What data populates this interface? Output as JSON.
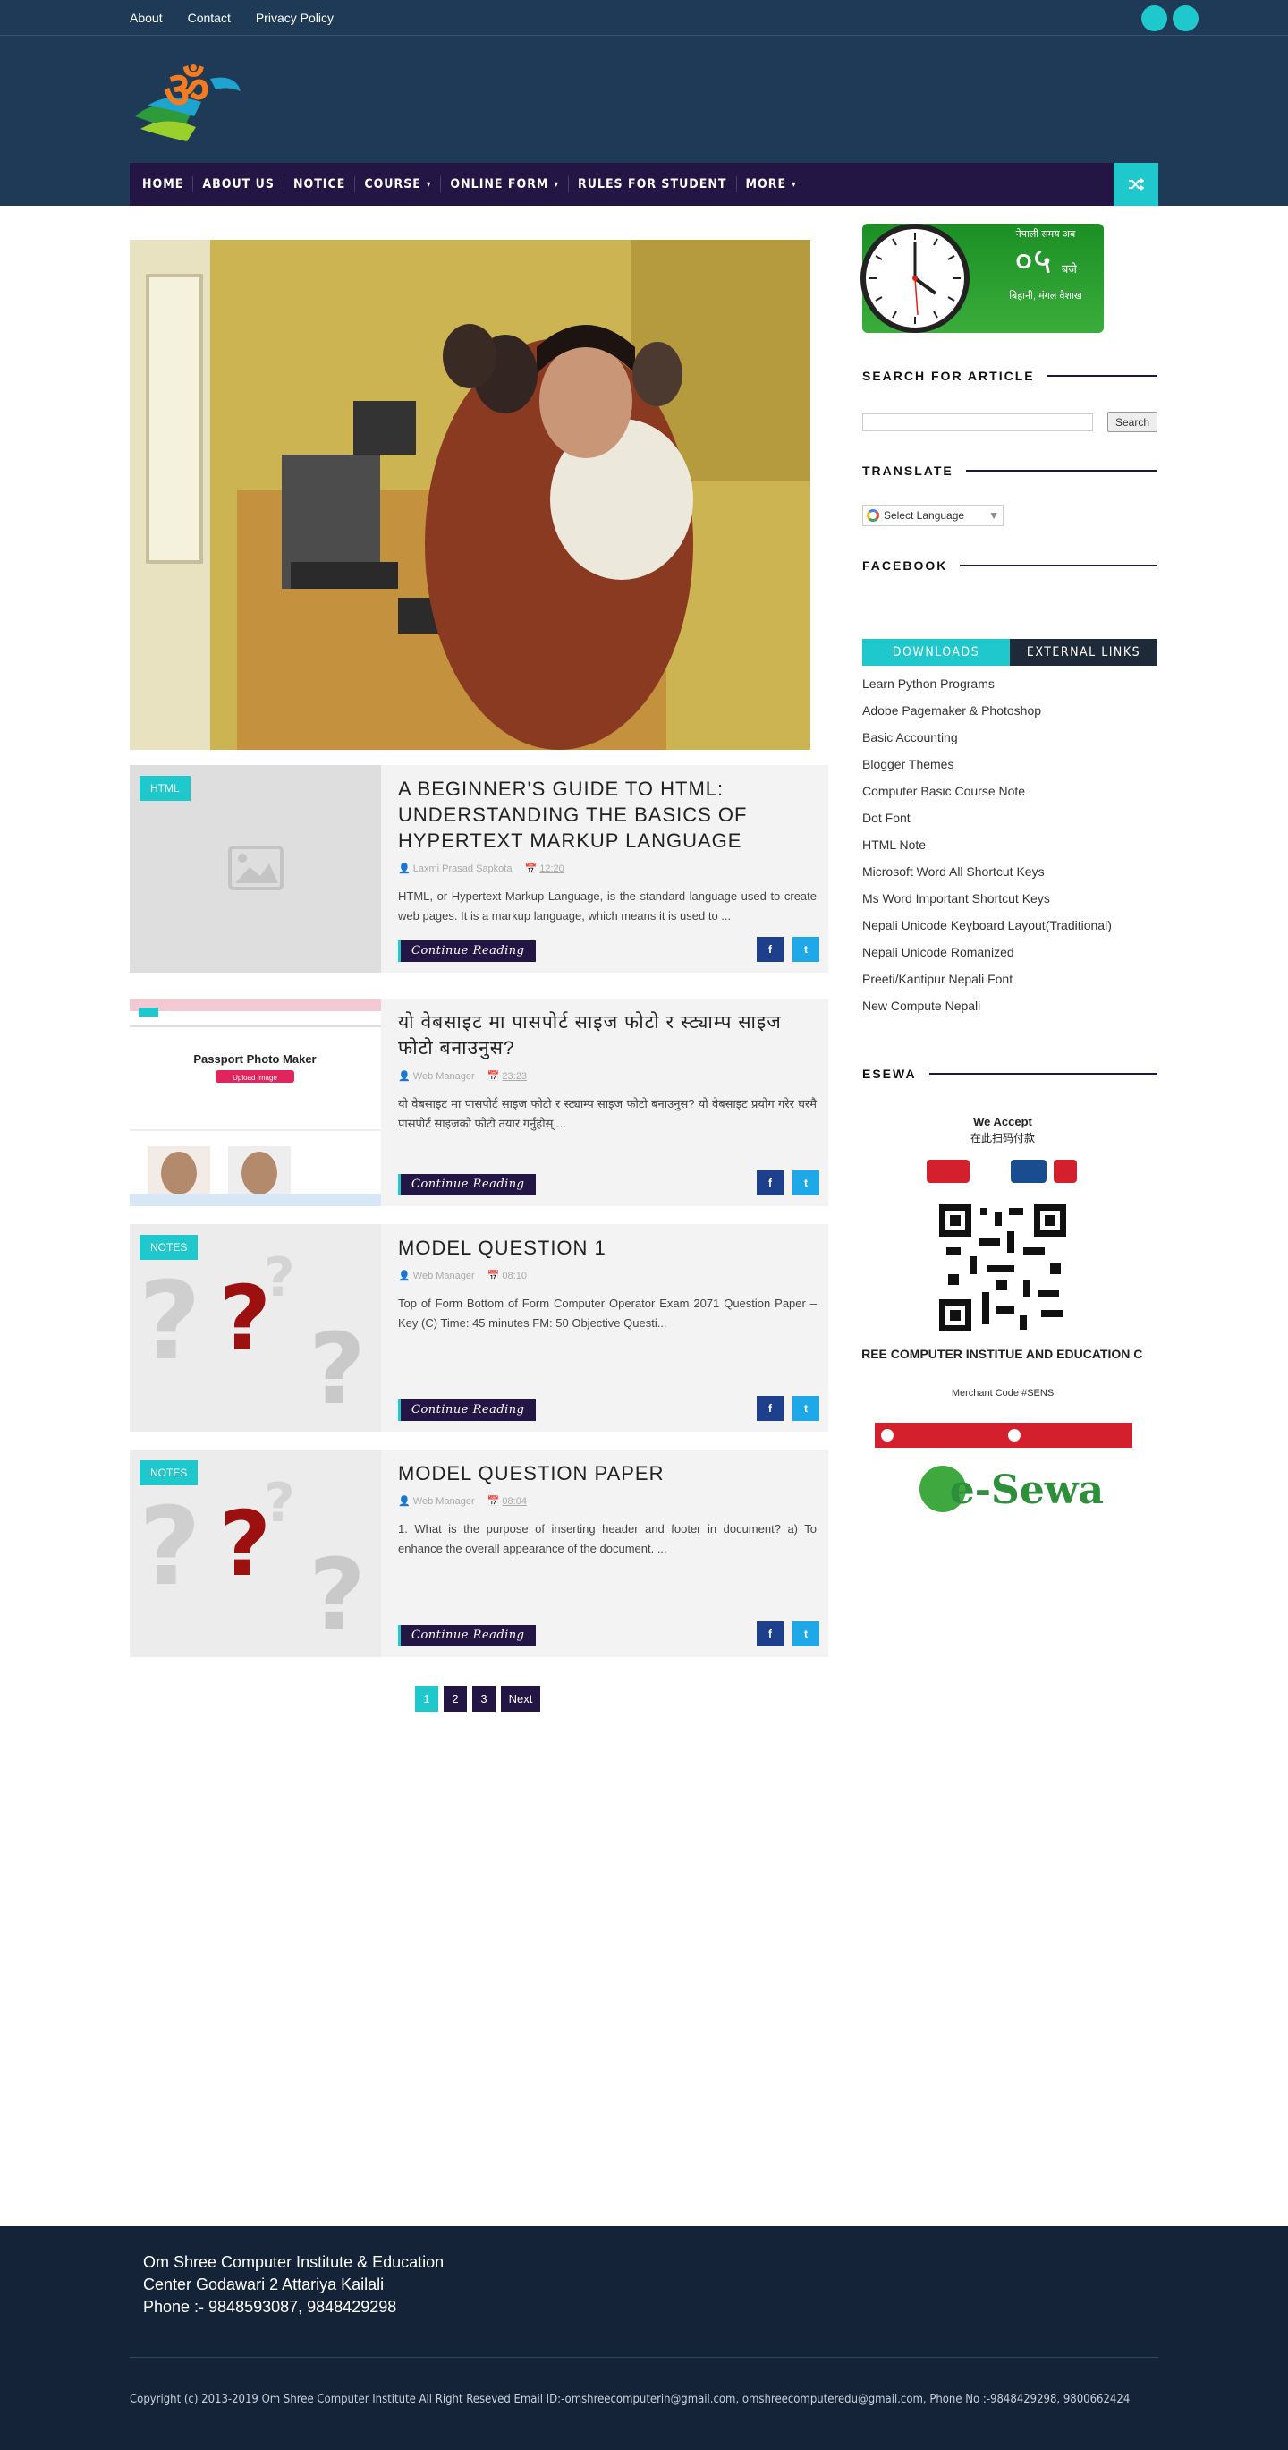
{
  "top_links": [
    "About",
    "Contact",
    "Privacy Policy"
  ],
  "nav": {
    "items": [
      "HOME",
      "ABOUT US",
      "NOTICE",
      "COURSE",
      "ONLINE FORM",
      "RULES FOR STUDENT",
      "MORE"
    ]
  },
  "posts": [
    {
      "label": "HTML",
      "title": "A BEGINNER'S GUIDE TO HTML: UNDERSTANDING THE BASICS OF HYPERTEXT MARKUP LANGUAGE",
      "author": "Laxmi Prasad Sapkota",
      "time": "12:20",
      "snippet": "HTML, or Hypertext Markup Language, is the standard language used to create web pages. It is a markup language, which means it is used to ..."
    },
    {
      "label": "",
      "title": "यो वेबसाइट मा पासपोर्ट साइज फोटो र स्ट्याम्प साइज फोटो बनाउनुस?",
      "author": "Web Manager",
      "time": "23:23",
      "snippet": "यो वेबसाइट मा पासपोर्ट साइज फोटो र स्ट्याम्प साइज फोटो बनाउनुस? यो वेबसाइट प्रयोग गरेर घरमै पासपोर्ट साइजको फोटो तयार गर्नुहोस् ..."
    },
    {
      "label": "NOTES",
      "title": "MODEL QUESTION 1",
      "author": "Web Manager",
      "time": "08:10",
      "snippet": "Top of Form Bottom of Form Computer Operator Exam 2071 Question Paper – Key (C) Time: 45 minutes FM: 50 Objective Questi..."
    },
    {
      "label": "NOTES",
      "title": "MODEL QUESTION PAPER",
      "author": "Web Manager",
      "time": "08:04",
      "snippet": "1.      What is the purpose of inserting header and footer in document? a) To enhance the overall appearance of the document. ..."
    }
  ],
  "continue_label": "Continue Reading",
  "pagination": [
    "1",
    "2",
    "3",
    "Next"
  ],
  "sidebar": {
    "clock": {
      "head": "नेपाली समय अब",
      "big": "०५",
      "unit": "बजे",
      "sub": "बिहानी, मंगल वैशाख"
    },
    "search_title": "SEARCH FOR ARTICLE",
    "search_button": "Search",
    "translate_title": "TRANSLATE",
    "translate_select": "Select Language",
    "facebook_title": "FACEBOOK",
    "tabs": [
      "DOWNLOADS",
      "EXTERNAL LINKS"
    ],
    "links": [
      "Learn Python Programs",
      "Adobe Pagemaker & Photoshop",
      "Basic Accounting",
      "Blogger Themes",
      "Computer Basic Course Note",
      "Dot Font",
      "HTML Note",
      "Microsoft Word All Shortcut Keys",
      "Ms Word Important Shortcut Keys",
      "Nepali Unicode Keyboard Layout(Traditional)",
      "Nepali Unicode Romanized",
      "Preeti/Kantipur Nepali Font",
      "New Compute Nepali"
    ],
    "esewa_title": "ESEWA",
    "esewa": {
      "accept": "We Accept",
      "accept_cn": "在此扫码付款",
      "name": "OM SHREE COMPUTER INSTITUE AND EDUCATION CENTER",
      "merchant": "Merchant Code #SENS",
      "brand": "e-Sewa"
    }
  },
  "footer": {
    "line1": "Om Shree Computer Institute & Education",
    "line2": "Center Godawari 2 Attariya Kailali",
    "line3": "Phone :- 9848593087, 9848429298",
    "copyright": "Copyright (c) 2013-2019 Om Shree Computer Institute All Right Reseved Email ID:-omshreecomputerin@gmail.com, omshreecomputeredu@gmail.com, Phone No :-9848429298, 9800662424"
  },
  "colors": {
    "header_bg": "#1e3a56",
    "nav_bg": "#231544",
    "accent": "#1fc8cc",
    "footer_bg": "#142338"
  }
}
